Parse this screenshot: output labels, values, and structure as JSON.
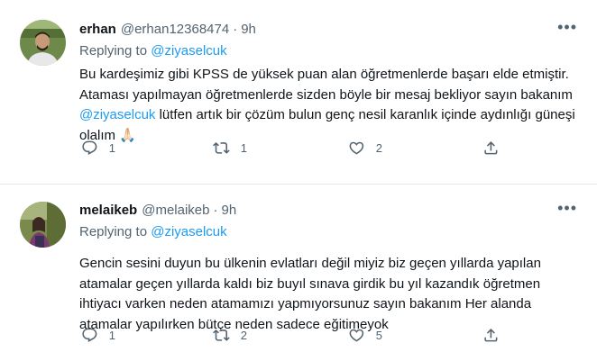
{
  "tweets": [
    {
      "name": "erhan",
      "handle": "@erhan12368474",
      "dot": "·",
      "time": "9h",
      "replying_prefix": "Replying to",
      "replying_to": "@ziyaselcuk",
      "text_part1": "Bu kardeşimiz gibi KPSS de yüksek puan alan öğretmenlerde başarı elde etmiştir. Ataması yapılmayan öğretmenlerde sizden böyle bir mesaj bekliyor sayın bakanım ",
      "text_mention": "@ziyaselcuk",
      "text_part2": " lütfen artık bir çözüm bulun genç nesil karanlık içinde aydınlığı güneşi olalım 🙏🏻",
      "replies": "1",
      "retweets": "1",
      "likes": "2",
      "avatar_icon": "user-avatar-icon"
    },
    {
      "name": "melaikeb",
      "handle": "@melaikeb",
      "dot": "·",
      "time": "9h",
      "replying_prefix": "Replying to",
      "replying_to": "@ziyaselcuk",
      "text": "Gencin sesini duyun bu ülkenin evlatları değil miyiz biz geçen yıllarda yapılan atamalar geçen yıllarda kaldı biz buyıl sınava girdik bu yıl kazandık öğretmen ihtiyacı varken neden atamamızı yapmıyorsunuz sayın bakanım Her alanda atamalar yapılırken bütçe neden sadece eğitimeyok",
      "replies": "1",
      "retweets": "2",
      "likes": "5",
      "avatar_icon": "user-avatar-icon"
    }
  ],
  "more_glyph": "•••",
  "colors": {
    "link": "#1d9bf0",
    "secondary": "#536471",
    "divider": "#e1e8ed"
  }
}
